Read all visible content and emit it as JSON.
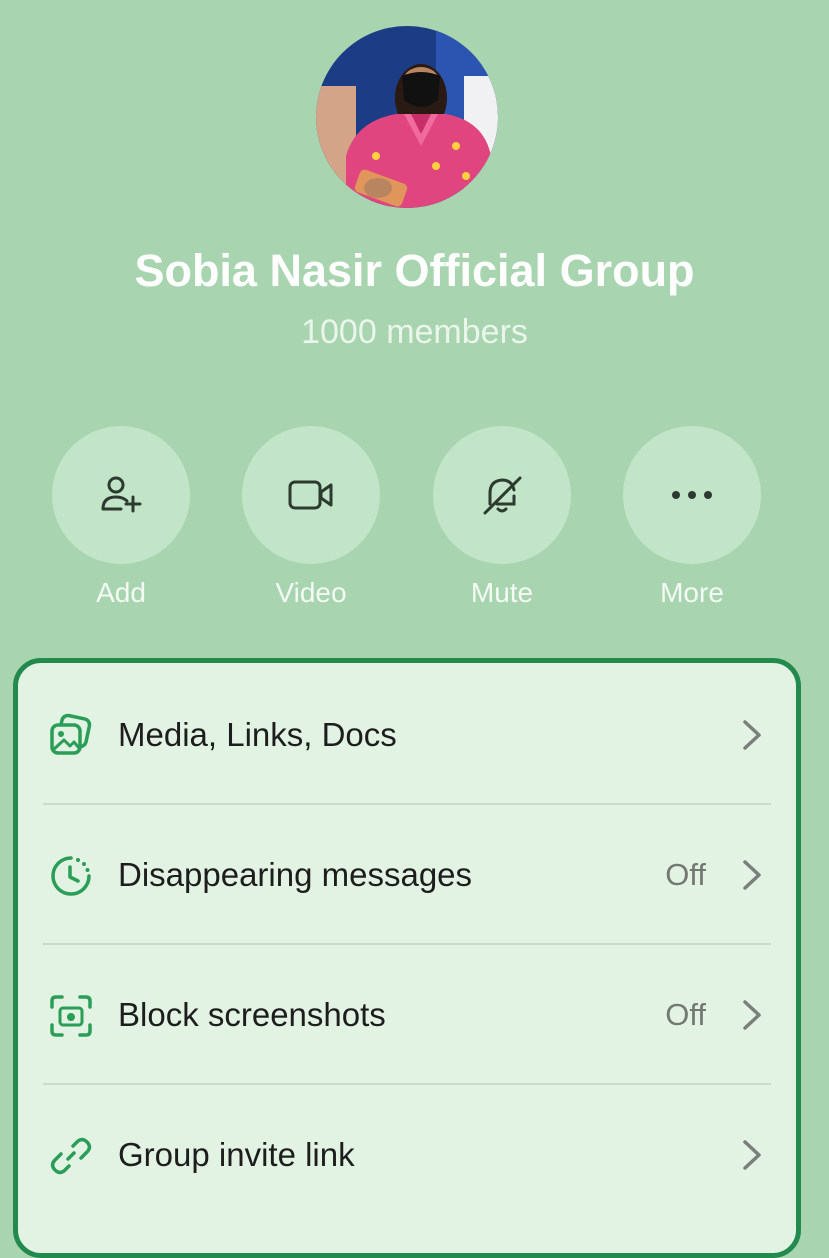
{
  "group": {
    "name": "Sobia Nasir Official Group",
    "member_count": "1000 members"
  },
  "actions": [
    {
      "label": "Add",
      "icon": "add-person-icon"
    },
    {
      "label": "Video",
      "icon": "video-camera-icon"
    },
    {
      "label": "Mute",
      "icon": "bell-muted-icon"
    },
    {
      "label": "More",
      "icon": "more-dots-icon"
    }
  ],
  "settings": [
    {
      "label": "Media, Links, Docs",
      "value": "",
      "icon": "media-gallery-icon"
    },
    {
      "label": "Disappearing messages",
      "value": "Off",
      "icon": "timer-icon"
    },
    {
      "label": "Block screenshots",
      "value": "Off",
      "icon": "screenshot-camera-icon"
    },
    {
      "label": "Group invite link",
      "value": "",
      "icon": "link-icon"
    }
  ],
  "colors": {
    "background": "#a8d4b0",
    "action_circle": "#c2e4c8",
    "card_background": "#e2f3e4",
    "card_border": "#238a4e",
    "accent_icon": "#2a9d57",
    "secondary_text": "#737873"
  }
}
